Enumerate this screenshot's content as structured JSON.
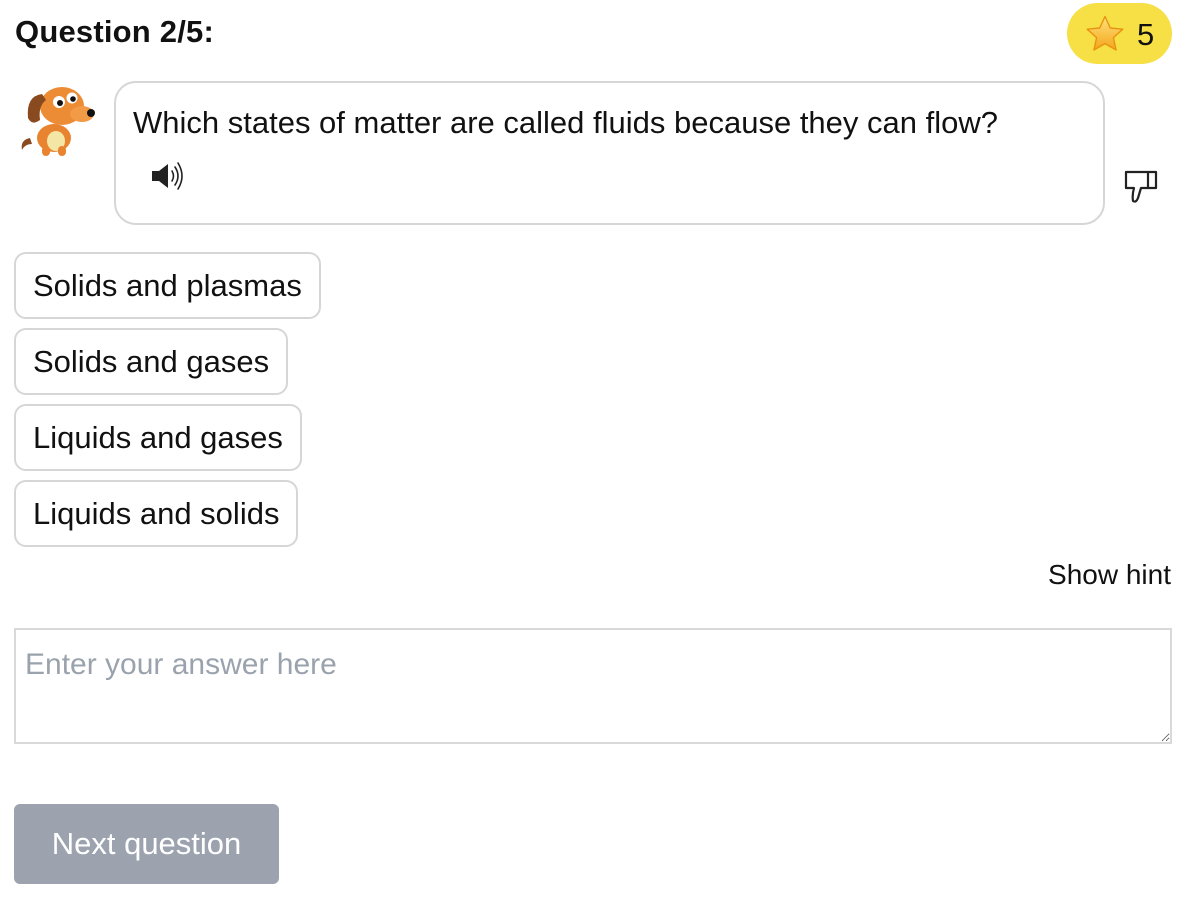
{
  "header": {
    "title": "Question 2/5:",
    "score": "5",
    "score_icon": "star-icon",
    "badge_color": "#f6e045"
  },
  "question": {
    "text": "Which states of matter are called fluids because they can flow?",
    "audio_icon": "speaker-icon",
    "feedback_icon": "thumbs-down-icon"
  },
  "options": [
    {
      "label": "Solids and plasmas"
    },
    {
      "label": "Solids and gases"
    },
    {
      "label": "Liquids and gases"
    },
    {
      "label": "Liquids and solids"
    }
  ],
  "hint": {
    "label": "Show hint"
  },
  "answer": {
    "placeholder": "Enter your answer here",
    "value": ""
  },
  "footer": {
    "next_label": "Next question",
    "next_color": "#9ca3af"
  }
}
